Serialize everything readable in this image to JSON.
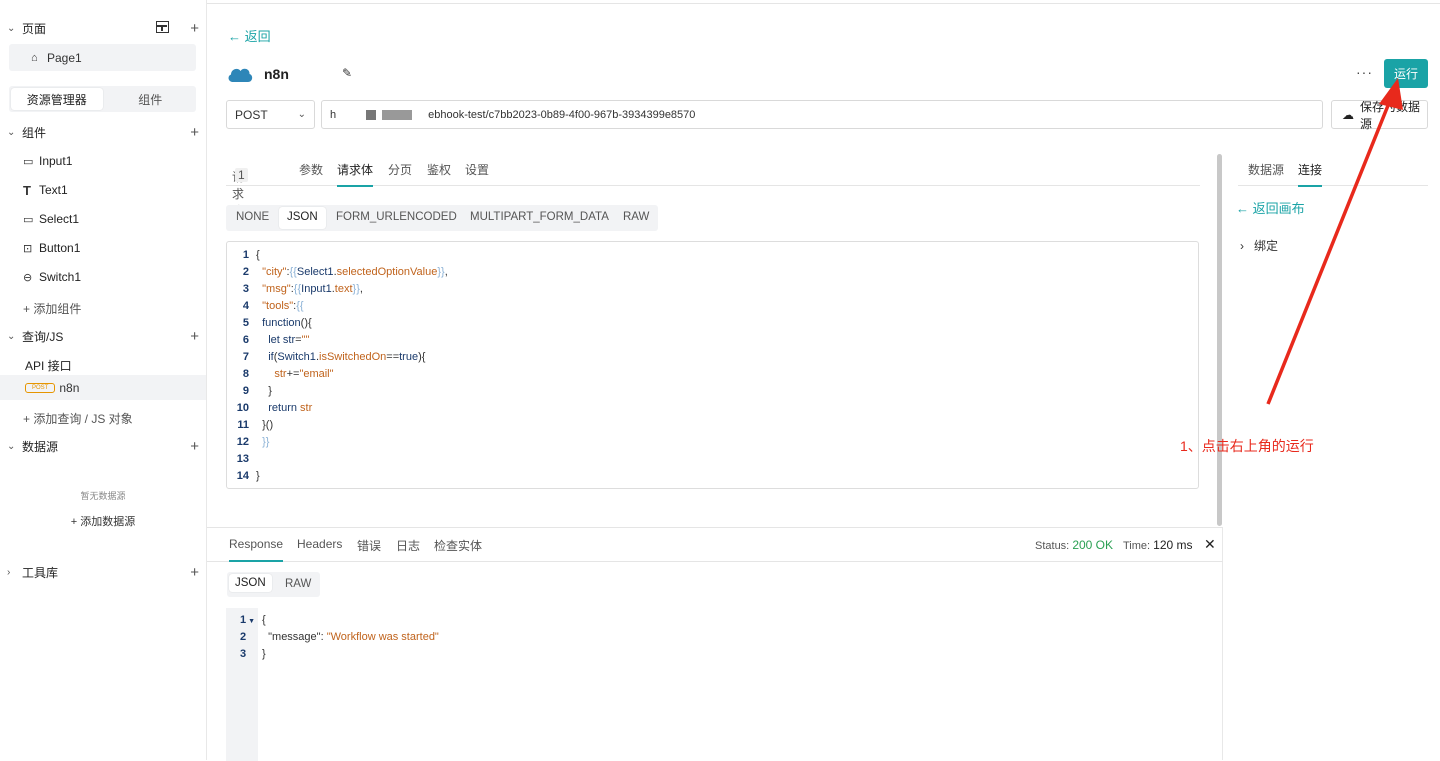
{
  "sidebar": {
    "pages_title": "页面",
    "page_item": "Page1",
    "tab_resources": "资源管理器",
    "tab_components": "组件",
    "components_title": "组件",
    "components": [
      {
        "label": "Input1",
        "icon": "input-icon"
      },
      {
        "label": "Text1",
        "icon": "text-icon"
      },
      {
        "label": "Select1",
        "icon": "select-icon"
      },
      {
        "label": "Button1",
        "icon": "button-icon"
      },
      {
        "label": "Switch1",
        "icon": "switch-icon"
      }
    ],
    "add_component": "添加组件",
    "query_title": "查询/JS",
    "api_group": "API 接口",
    "api_item": {
      "method": "POST",
      "name": "n8n"
    },
    "add_query": "添加查询 / JS 对象",
    "datasource_title": "数据源",
    "no_datasource": "暂无数据源",
    "add_datasource": "添加数据源",
    "toolbox_title": "工具库"
  },
  "main": {
    "back": "返回",
    "api_name": "n8n",
    "run_label": "运行",
    "more": "···",
    "method": "POST",
    "url_prefix": "h",
    "url_suffix": "ebhook-test/c7bb2023-0b89-4f00-967b-3934399e8570",
    "save_label": "保存为数据源",
    "req_tabs": [
      "请求头",
      "参数",
      "请求体",
      "分页",
      "鉴权",
      "设置"
    ],
    "req_header_count": "1",
    "active_req_tab": "请求体",
    "body_types": [
      "NONE",
      "JSON",
      "FORM_URLENCODED",
      "MULTIPART_FORM_DATA",
      "RAW"
    ],
    "active_body_type": "JSON",
    "code_lines": [
      "1",
      "2",
      "3",
      "4",
      "5",
      "6",
      "7",
      "8",
      "9",
      "10",
      "11",
      "12",
      "13",
      "14"
    ]
  },
  "right_panel": {
    "tabs": [
      "数据源",
      "连接"
    ],
    "active_tab": "连接",
    "back_canvas": "返回画布",
    "bind": "绑定"
  },
  "annotation": {
    "text": "1、点击右上角的运行",
    "color": "#e8291c"
  },
  "response": {
    "tabs": [
      "Response",
      "Headers",
      "错误",
      "日志",
      "检查实体"
    ],
    "active_tab": "Response",
    "status_label": "Status:",
    "status_value": "200 OK",
    "time_label": "Time:",
    "time_value": "120 ms",
    "types": [
      "JSON",
      "RAW"
    ],
    "active_type": "JSON",
    "line_numbers": [
      "1",
      "2",
      "3"
    ],
    "body": {
      "key": "\"message\"",
      "value": "\"Workflow was started\""
    }
  },
  "colors": {
    "accent": "#1aa3a6",
    "post_badge": "#e69500",
    "success": "#2aa053"
  }
}
